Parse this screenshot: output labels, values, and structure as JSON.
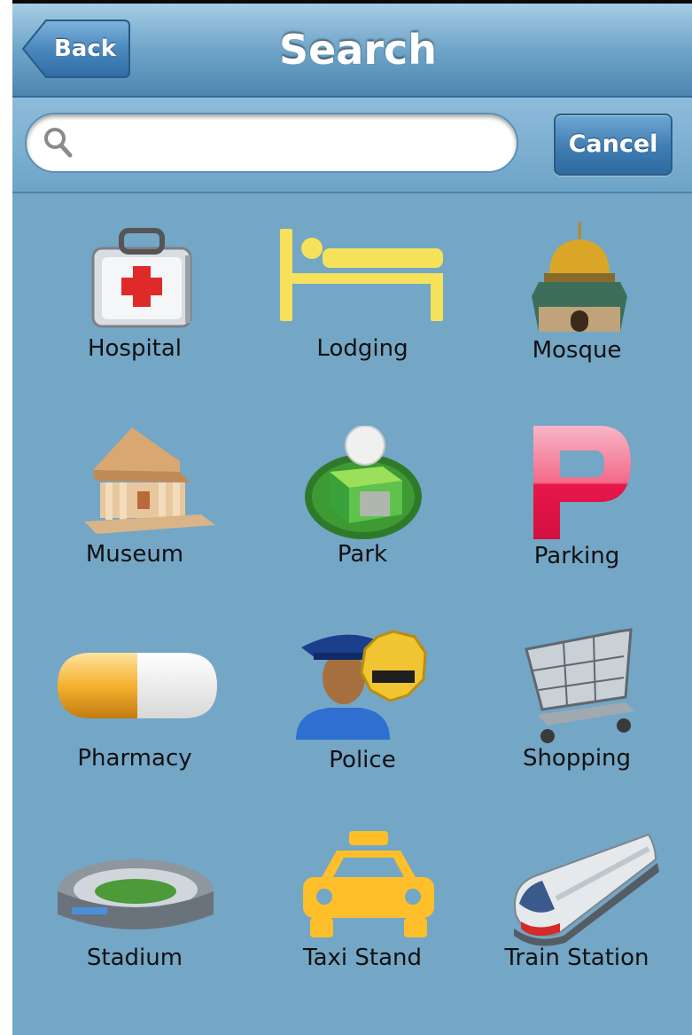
{
  "nav": {
    "back_label": "Back",
    "title": "Search"
  },
  "search": {
    "value": "",
    "placeholder": "",
    "cancel_label": "Cancel"
  },
  "categories": [
    {
      "label": "Hospital",
      "icon": "first-aid-kit-icon"
    },
    {
      "label": "Lodging",
      "icon": "bed-icon"
    },
    {
      "label": "Mosque",
      "icon": "mosque-icon"
    },
    {
      "label": "Museum",
      "icon": "museum-icon"
    },
    {
      "label": "Park",
      "icon": "park-icon"
    },
    {
      "label": "Parking",
      "icon": "parking-icon"
    },
    {
      "label": "Pharmacy",
      "icon": "pill-icon"
    },
    {
      "label": "Police",
      "icon": "police-icon"
    },
    {
      "label": "Shopping",
      "icon": "shopping-cart-icon"
    },
    {
      "label": "Stadium",
      "icon": "stadium-icon"
    },
    {
      "label": "Taxi Stand",
      "icon": "taxi-icon"
    },
    {
      "label": "Train Station",
      "icon": "train-icon"
    }
  ],
  "colors": {
    "background": "#74a6c6",
    "navbar": "#5f97be",
    "cancel_button": "#3f7db2",
    "parking_red": "#e8174a",
    "lodging_yellow": "#f7e35a",
    "taxi_yellow": "#ffbf2a"
  }
}
